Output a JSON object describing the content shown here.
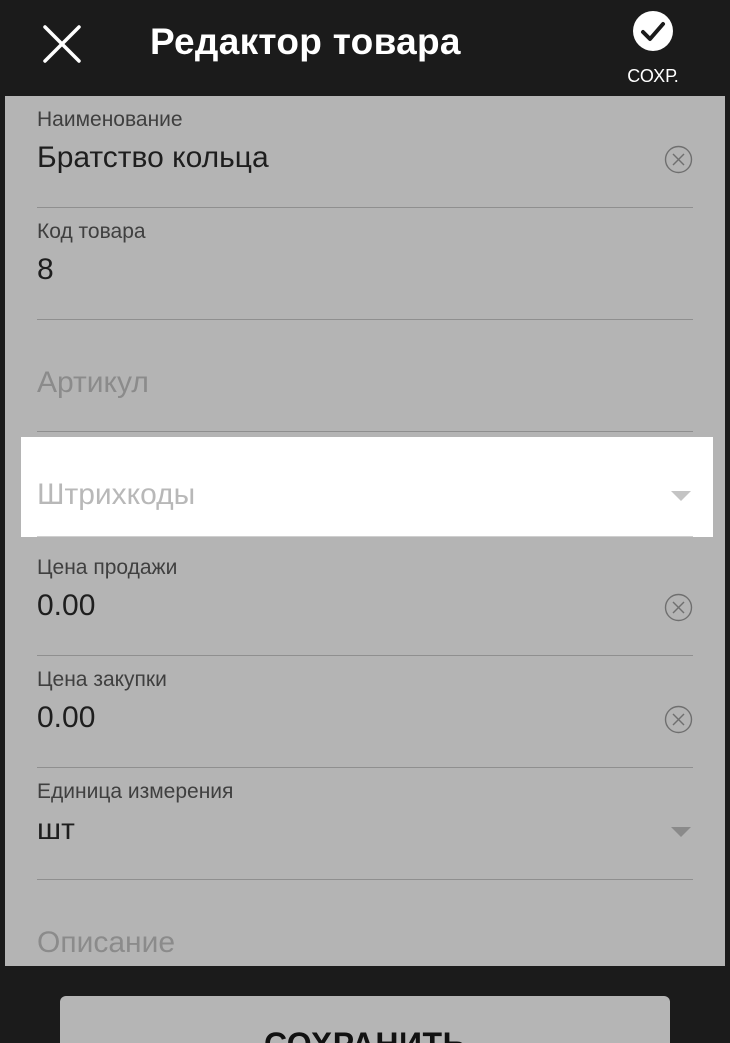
{
  "toolbar": {
    "title": "Редактор товара",
    "close_icon": "close-icon",
    "save_icon": "check-circle-icon",
    "save_label": "СОХР."
  },
  "fields": {
    "name": {
      "label": "Наименование",
      "value": "Братство кольца",
      "icon": "clear-icon"
    },
    "code": {
      "label": "Код товара",
      "value": "8"
    },
    "article": {
      "placeholder": "Артикул"
    },
    "barcodes": {
      "placeholder": "Штрихкоды",
      "icon": "dropdown-arrow-icon"
    },
    "sale_price": {
      "label": "Цена продажи",
      "value": "0.00",
      "icon": "clear-icon"
    },
    "purchase_price": {
      "label": "Цена закупки",
      "value": "0.00",
      "icon": "clear-icon"
    },
    "unit": {
      "label": "Единица измерения",
      "value": "шт",
      "icon": "dropdown-arrow-icon"
    },
    "description": {
      "placeholder": "Описание"
    }
  },
  "bottom": {
    "save_button_label": "СОХРАНИТЬ"
  },
  "colors": {
    "toolbar_bg": "#1b1b1b",
    "dim_overlay": "#b4b4b4",
    "highlight_bg": "#ffffff"
  }
}
